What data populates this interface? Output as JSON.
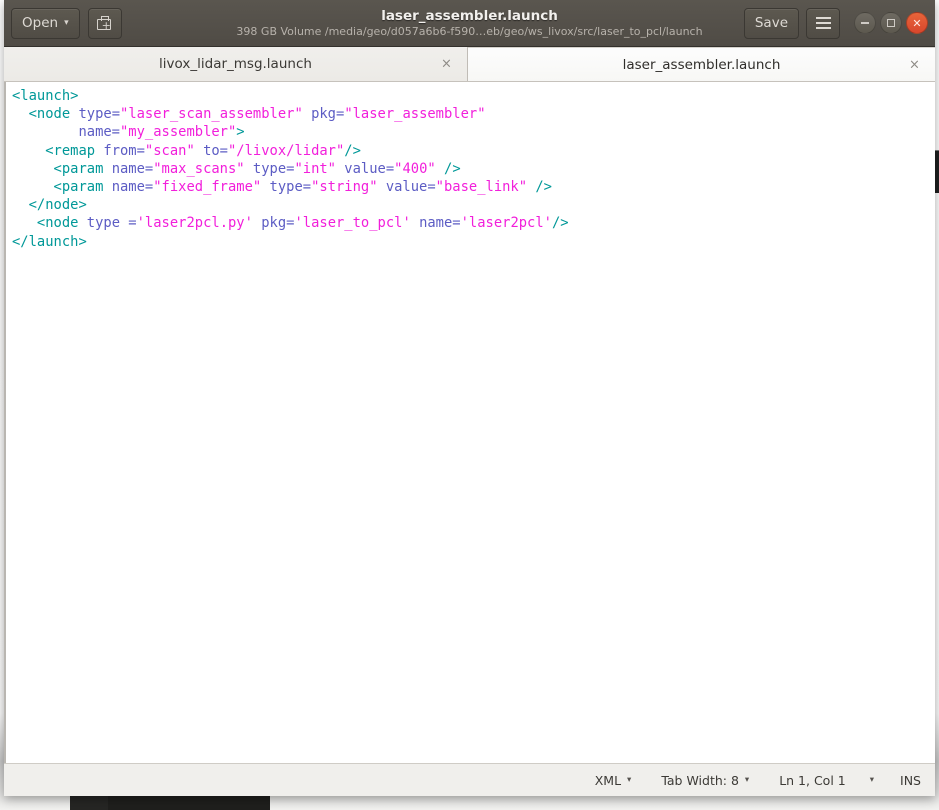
{
  "window": {
    "title": "laser_assembler.launch",
    "subtitle": "398 GB Volume /media/geo/d057a6b6-f590…eb/geo/ws_livox/src/laser_to_pcl/launch"
  },
  "headerbar": {
    "open_label": "Open",
    "open_caret": "▾",
    "saveas_icon": "save-as-icon",
    "save_label": "Save",
    "menu_icon": "hamburger-menu-icon",
    "minimize_icon": "minimize-icon",
    "maximize_icon": "maximize-icon",
    "close_icon": "close-icon"
  },
  "tabs": [
    {
      "label": "livox_lidar_msg.launch",
      "close": "×",
      "active": false
    },
    {
      "label": "laser_assembler.launch",
      "close": "×",
      "active": true
    }
  ],
  "editor": {
    "language": "XML",
    "lines": [
      [
        {
          "t": "tag",
          "s": "<launch>"
        }
      ],
      [
        {
          "t": "plain",
          "s": "  "
        },
        {
          "t": "tag",
          "s": "<node"
        },
        {
          "t": "attr",
          "s": " type="
        },
        {
          "t": "val",
          "s": "\"laser_scan_assembler\""
        },
        {
          "t": "attr",
          "s": " pkg="
        },
        {
          "t": "val",
          "s": "\"laser_assembler\""
        }
      ],
      [
        {
          "t": "plain",
          "s": "        "
        },
        {
          "t": "attr",
          "s": "name="
        },
        {
          "t": "val",
          "s": "\"my_assembler\""
        },
        {
          "t": "tag",
          "s": ">"
        }
      ],
      [
        {
          "t": "plain",
          "s": "    "
        },
        {
          "t": "tag",
          "s": "<remap"
        },
        {
          "t": "attr",
          "s": " from="
        },
        {
          "t": "val",
          "s": "\"scan\""
        },
        {
          "t": "attr",
          "s": " to="
        },
        {
          "t": "val",
          "s": "\"/livox/lidar\""
        },
        {
          "t": "tag",
          "s": "/>"
        }
      ],
      [
        {
          "t": "plain",
          "s": "     "
        },
        {
          "t": "tag",
          "s": "<param"
        },
        {
          "t": "attr",
          "s": " name="
        },
        {
          "t": "val",
          "s": "\"max_scans\""
        },
        {
          "t": "attr",
          "s": " type="
        },
        {
          "t": "val",
          "s": "\"int\""
        },
        {
          "t": "attr",
          "s": " value="
        },
        {
          "t": "val",
          "s": "\"400\""
        },
        {
          "t": "tag",
          "s": " />"
        }
      ],
      [
        {
          "t": "plain",
          "s": "     "
        },
        {
          "t": "tag",
          "s": "<param"
        },
        {
          "t": "attr",
          "s": " name="
        },
        {
          "t": "val",
          "s": "\"fixed_frame\""
        },
        {
          "t": "attr",
          "s": " type="
        },
        {
          "t": "val",
          "s": "\"string\""
        },
        {
          "t": "attr",
          "s": " value="
        },
        {
          "t": "val",
          "s": "\"base_link\""
        },
        {
          "t": "tag",
          "s": " />"
        }
      ],
      [
        {
          "t": "plain",
          "s": "  "
        },
        {
          "t": "tag",
          "s": "</node>"
        }
      ],
      [
        {
          "t": "plain",
          "s": "   "
        },
        {
          "t": "tag",
          "s": "<node"
        },
        {
          "t": "attr",
          "s": " type ="
        },
        {
          "t": "val",
          "s": "'laser2pcl.py'"
        },
        {
          "t": "attr",
          "s": " pkg="
        },
        {
          "t": "val",
          "s": "'laser_to_pcl'"
        },
        {
          "t": "attr",
          "s": " name="
        },
        {
          "t": "val",
          "s": "'laser2pcl'"
        },
        {
          "t": "tag",
          "s": "/>"
        }
      ],
      [
        {
          "t": "tag",
          "s": "</launch>"
        }
      ]
    ]
  },
  "statusbar": {
    "language_label": "XML",
    "language_caret": "▾",
    "tabwidth_label": "Tab Width: 8",
    "tabwidth_caret": "▾",
    "position_label": "Ln 1, Col 1",
    "position_caret": "▾",
    "insert_mode": "INS"
  },
  "colors": {
    "headerbar_bg": "#524e47",
    "tag": "#009898",
    "attribute": "#5c5cc4",
    "value": "#f21fdb",
    "close_button": "#d8472c",
    "editor_bg": "#ffffff",
    "statusbar_bg": "#f0efec"
  }
}
